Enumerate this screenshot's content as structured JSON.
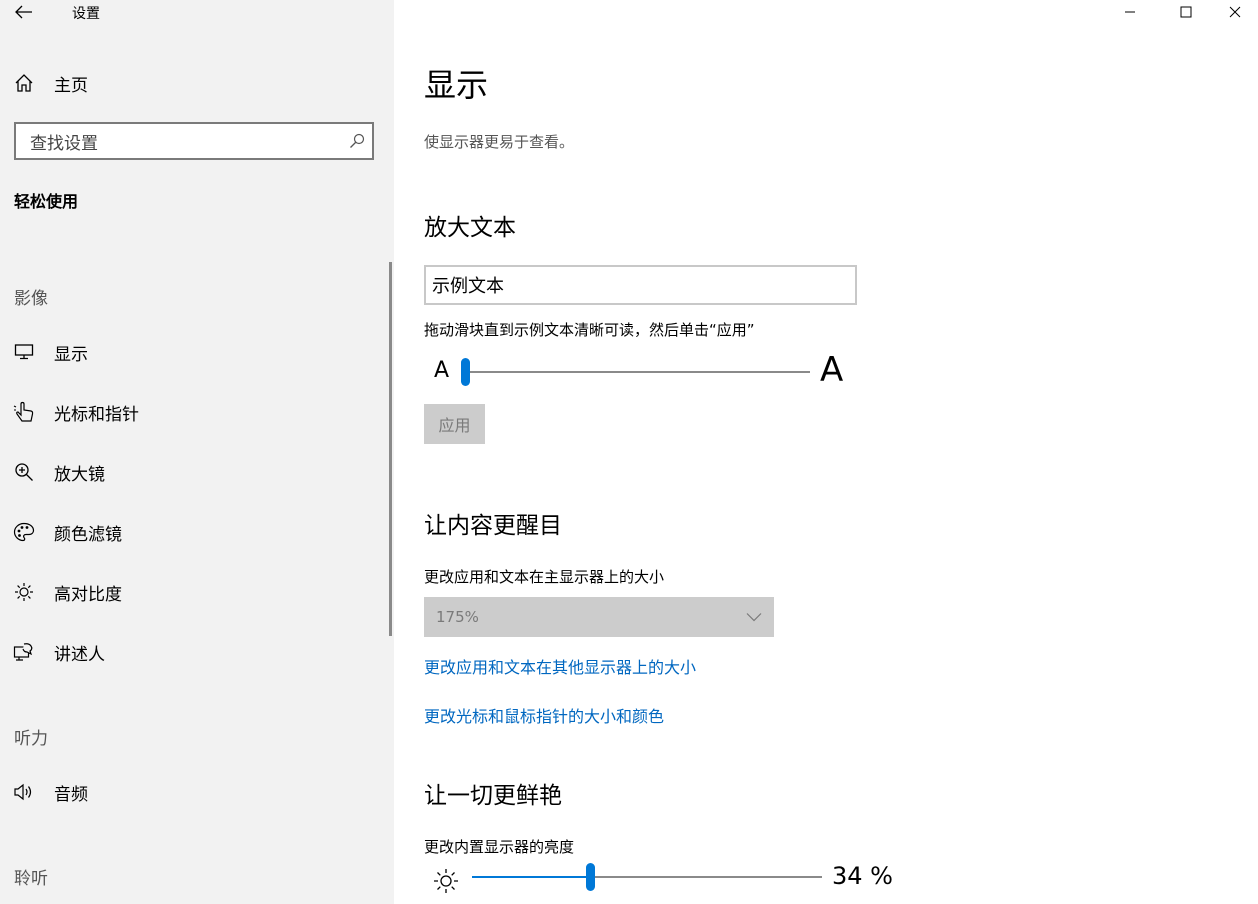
{
  "window": {
    "title": "设置"
  },
  "sidebar": {
    "home_label": "主页",
    "search_placeholder": "查找设置",
    "category": "轻松使用",
    "groups": {
      "vision": "影像",
      "hearing": "听力",
      "interaction": "聆听"
    },
    "items": [
      {
        "label": "显示",
        "icon": "monitor-icon"
      },
      {
        "label": "光标和指针",
        "icon": "pointer-icon"
      },
      {
        "label": "放大镜",
        "icon": "magnifier-icon"
      },
      {
        "label": "颜色滤镜",
        "icon": "palette-icon"
      },
      {
        "label": "高对比度",
        "icon": "sun-icon"
      },
      {
        "label": "讲述人",
        "icon": "narrator-icon"
      },
      {
        "label": "音频",
        "icon": "speaker-icon"
      }
    ]
  },
  "main": {
    "title": "显示",
    "subtitle": "使显示器更易于查看。",
    "sections": {
      "bigger_text": {
        "title": "放大文本",
        "sample_text": "示例文本",
        "hint": "拖动滑块直到示例文本清晰可读，然后单击“应用”",
        "small_a": "A",
        "big_a": "A",
        "slider_value": 0,
        "apply_label": "应用"
      },
      "bigger_everything": {
        "title": "让内容更醒目",
        "scale_label": "更改应用和文本在主显示器上的大小",
        "scale_value": "175%",
        "link_other_displays": "更改应用和文本在其他显示器上的大小",
        "link_cursor": "更改光标和鼠标指针的大小和颜色"
      },
      "brighter": {
        "title": "让一切更鲜艳",
        "brightness_label": "更改内置显示器的亮度",
        "brightness_value": 34,
        "brightness_text": "34 %"
      }
    }
  },
  "colors": {
    "accent": "#0078d7",
    "link": "#0067c0",
    "sidebar_bg": "#f2f2f2",
    "disabled_bg": "#cccccc"
  }
}
